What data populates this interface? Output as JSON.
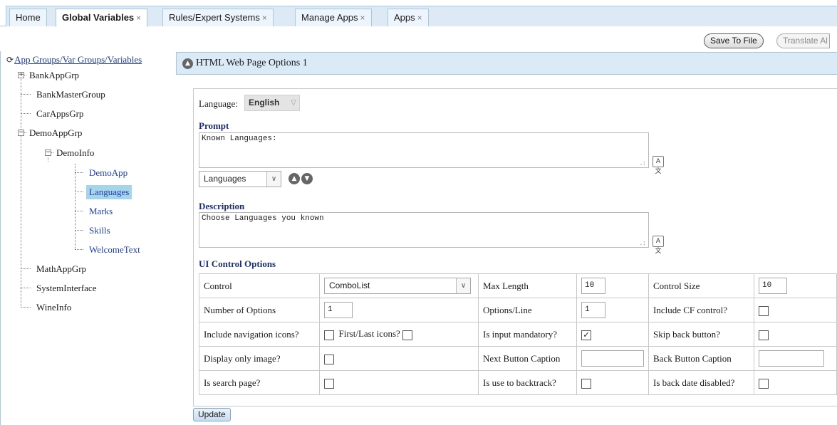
{
  "tabs": [
    {
      "label": "Home",
      "closable": false,
      "active": false
    },
    {
      "label": "Global Variables",
      "closable": true,
      "active": true
    },
    {
      "label": "Rules/Expert Systems",
      "closable": true,
      "active": false
    },
    {
      "label": "Manage Apps",
      "closable": true,
      "active": false
    },
    {
      "label": "Apps",
      "closable": true,
      "active": false
    }
  ],
  "tab_close_glyph": "×",
  "toolbar": {
    "save_label": "Save To File",
    "translate_label": "Translate Al"
  },
  "tree": {
    "root_label": "App Groups/Var Groups/Variables",
    "items": [
      {
        "label": "BankAppGrp",
        "expander": "+"
      },
      {
        "label": "BankMasterGroup"
      },
      {
        "label": "CarAppsGrp"
      },
      {
        "label": "DemoAppGrp",
        "expander": "−"
      },
      {
        "label": "DemoInfo",
        "expander": "−"
      },
      {
        "label": "DemoApp"
      },
      {
        "label": "Languages",
        "selected": true
      },
      {
        "label": "Marks"
      },
      {
        "label": "Skills"
      },
      {
        "label": "WelcomeText"
      },
      {
        "label": "MathAppGrp"
      },
      {
        "label": "SystemInterface"
      },
      {
        "label": "WineInfo"
      }
    ]
  },
  "panel": {
    "title": "HTML Web Page Options 1"
  },
  "form": {
    "language_label": "Language:",
    "language_value": "English",
    "prompt_label": "Prompt",
    "prompt_value": "Known Languages:",
    "prompt_select_value": "Languages",
    "description_label": "Description",
    "description_value": "Choose Languages you known",
    "ui_options_label": "UI Control Options",
    "update_label": "Update"
  },
  "options": {
    "control_label": "Control",
    "control_value": "ComboList",
    "max_length_label": "Max Length",
    "max_length_value": "10",
    "control_size_label": "Control Size",
    "control_size_value": "10",
    "num_options_label": "Number of Options",
    "num_options_value": "1",
    "options_line_label": "Options/Line",
    "options_line_value": "1",
    "include_cf_label": "Include CF control?",
    "include_nav_label": "Include navigation icons?",
    "first_last_label": "First/Last icons?",
    "mandatory_label": "Is input mandatory?",
    "skip_back_label": "Skip back button?",
    "display_image_label": "Display only image?",
    "next_caption_label": "Next Button Caption",
    "back_caption_label": "Back Button Caption",
    "search_page_label": "Is search page?",
    "backtrack_label": "Is use to backtrack?",
    "back_date_label": "Is back date disabled?",
    "checkbox_states": {
      "include_cf": false,
      "include_nav": false,
      "first_last": false,
      "mandatory": true,
      "skip_back": false,
      "display_image": false,
      "search_page": false,
      "backtrack": false,
      "back_date": false
    }
  }
}
